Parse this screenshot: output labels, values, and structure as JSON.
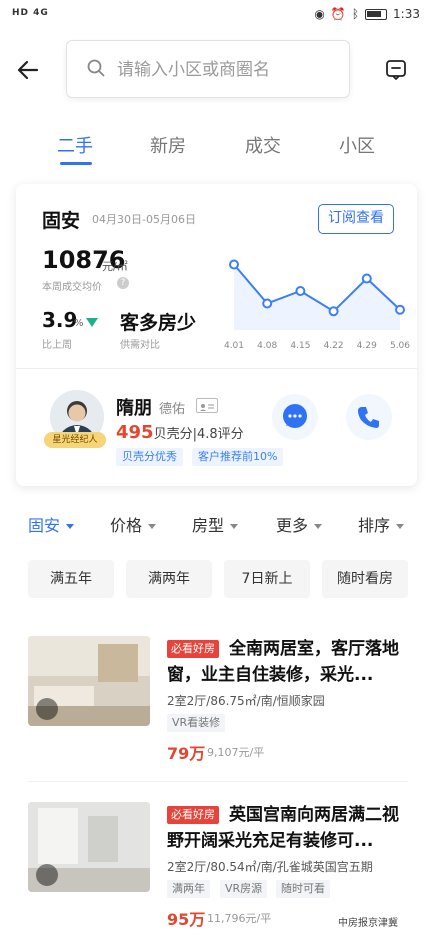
{
  "status_bar": {
    "left": "HD 4G",
    "time": "1:33"
  },
  "search": {
    "placeholder": "请输入小区或商圈名"
  },
  "tabs": [
    {
      "label": "二手",
      "active": true
    },
    {
      "label": "新房",
      "active": false
    },
    {
      "label": "成交",
      "active": false
    },
    {
      "label": "小区",
      "active": false
    }
  ],
  "market": {
    "city": "固安",
    "date_range": "04月30日-05月06日",
    "subscribe_label": "订阅查看",
    "avg_price": "10876",
    "avg_unit": "元/㎡",
    "avg_label": "本周成交均价",
    "wow_value": "3.9",
    "wow_unit": "%",
    "wow_label": "比上周",
    "supply_text": "客多房少",
    "supply_label": "供需对比"
  },
  "chart_data": {
    "type": "line",
    "categories": [
      "4.01",
      "4.08",
      "4.15",
      "4.22",
      "4.29",
      "5.06"
    ],
    "values": [
      82,
      57,
      65,
      52,
      73,
      53
    ],
    "title": "",
    "xlabel": "",
    "ylabel": "",
    "color": "#3a7ff7"
  },
  "agent": {
    "name": "隋朋",
    "company": "德佑",
    "tag": "星光经纪人",
    "score_value": "495",
    "score_text": "贝壳分|4.8评分",
    "badges": [
      "贝壳分优秀",
      "客户推荐前10%"
    ]
  },
  "filters": [
    {
      "label": "固安",
      "active": true
    },
    {
      "label": "价格",
      "active": false
    },
    {
      "label": "房型",
      "active": false
    },
    {
      "label": "更多",
      "active": false
    },
    {
      "label": "排序",
      "active": false
    }
  ],
  "quick_filters": [
    "满五年",
    "满两年",
    "7日新上",
    "随时看房"
  ],
  "listings": [
    {
      "badge": "必看好房",
      "title": "全南两居室，客厅落地窗，业主自住装修，采光...",
      "meta": "2室2厅/86.75㎡/南/恒顺家园",
      "tags": [
        "VR看装修"
      ],
      "price": "79万",
      "unit_price": "9,107元/平"
    },
    {
      "badge": "必看好房",
      "title": "英国宫南向两居满二视野开阔采光充足有装修可...",
      "meta": "2室2厅/80.54㎡/南/孔雀城英国宫五期",
      "tags": [
        "满两年",
        "VR房源",
        "随时可看"
      ],
      "price": "95万",
      "unit_price": "11,796元/平"
    }
  ],
  "watermark": "中房报京津冀"
}
